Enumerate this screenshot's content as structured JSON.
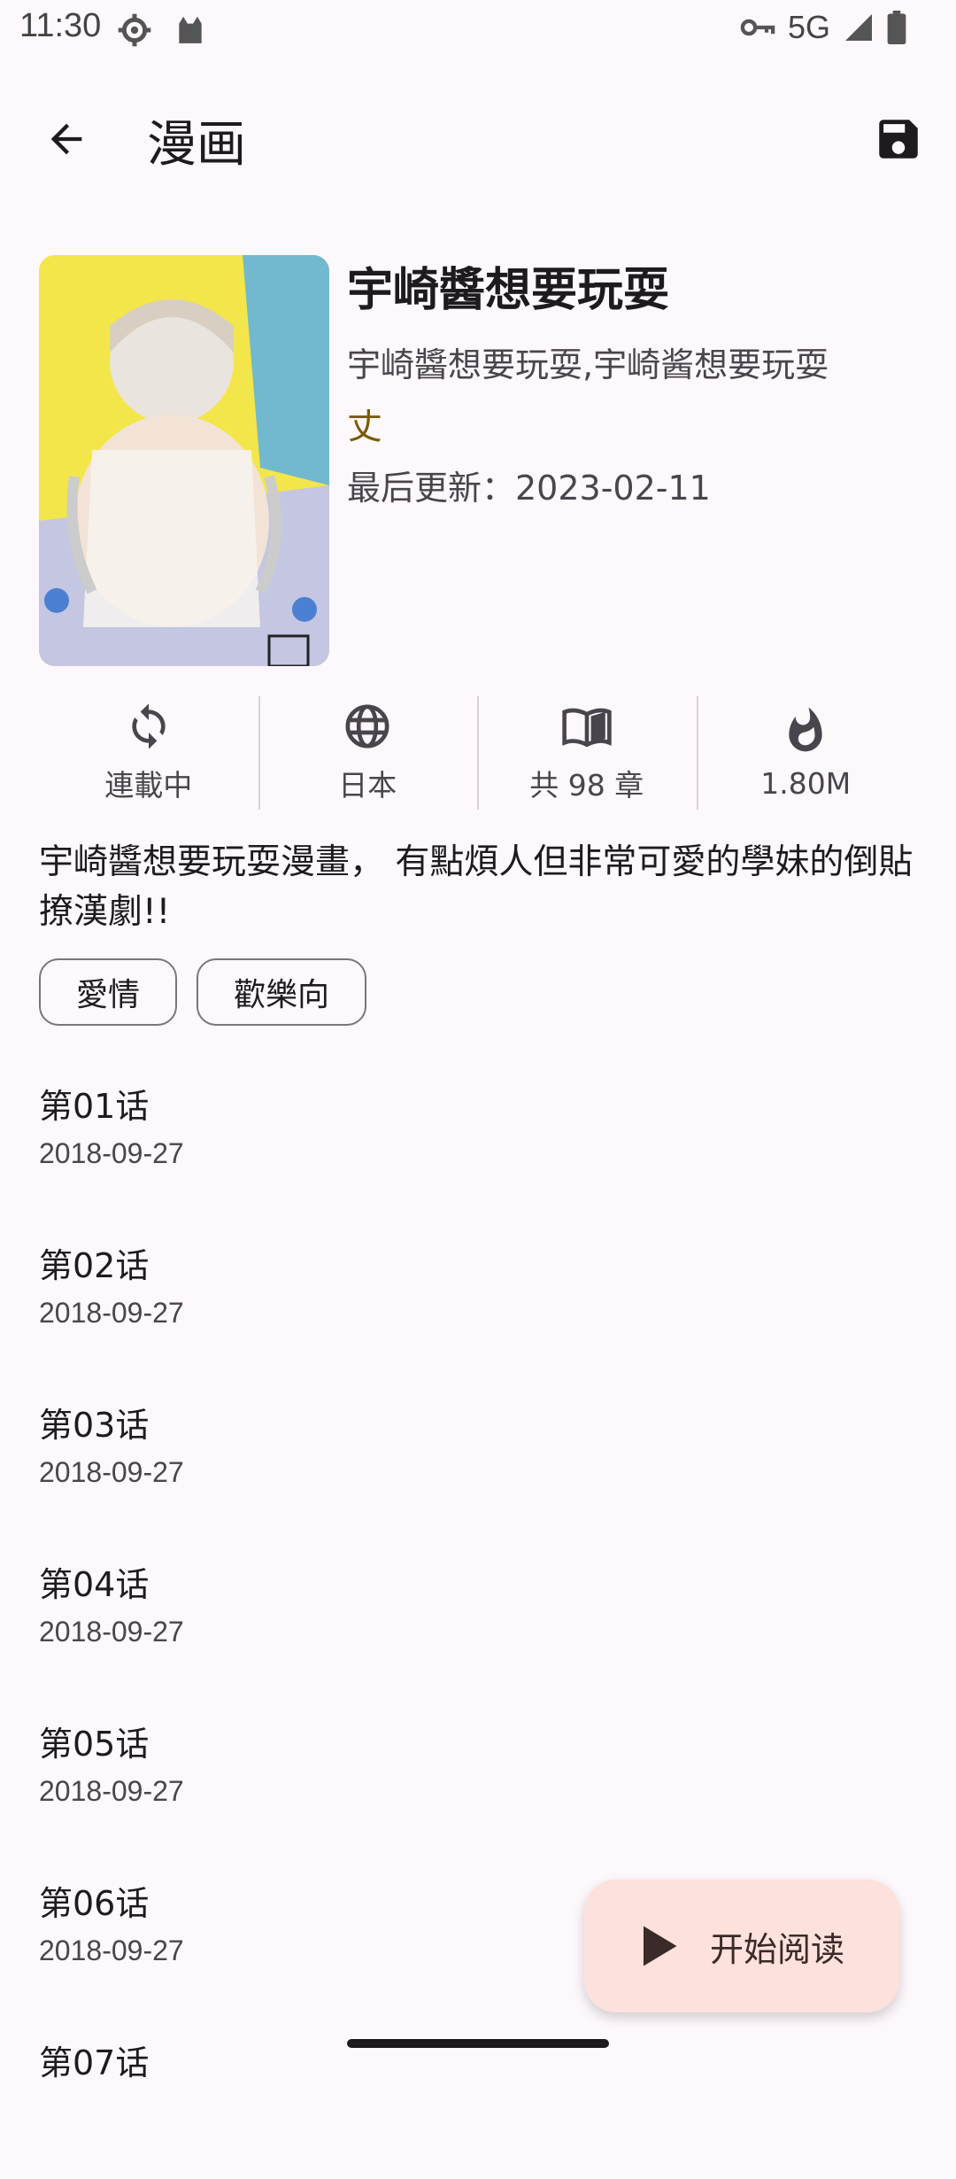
{
  "status_bar": {
    "time": "11:30",
    "network": "5G",
    "icons": [
      "settings-icon",
      "android-cat-icon",
      "vpn-key-icon",
      "signal-icon",
      "battery-icon"
    ]
  },
  "app_bar": {
    "title": "漫画",
    "back_icon": "arrow-back-icon",
    "save_icon": "save-icon"
  },
  "comic": {
    "title": "宇崎醬想要玩耍",
    "alt_names": "宇崎醬想要玩耍,宇崎酱想要玩耍",
    "author": "丈",
    "updated": "最后更新：2023-02-11",
    "description": "宇崎醬想要玩耍漫畫， 有點煩人但非常可愛的學妹的倒貼撩漢劇!!",
    "cover_alt": "宇崎醬想要玩耍 cover"
  },
  "stats": [
    {
      "icon": "refresh-icon",
      "label": "連載中"
    },
    {
      "icon": "globe-icon",
      "label": "日本"
    },
    {
      "icon": "book-open-icon",
      "label": "共 98 章"
    },
    {
      "icon": "flame-icon",
      "label": "1.80M"
    }
  ],
  "tags": [
    "愛情",
    "歡樂向"
  ],
  "chapters": [
    {
      "title": "第01话",
      "date": "2018-09-27"
    },
    {
      "title": "第02话",
      "date": "2018-09-27"
    },
    {
      "title": "第03话",
      "date": "2018-09-27"
    },
    {
      "title": "第04话",
      "date": "2018-09-27"
    },
    {
      "title": "第05话",
      "date": "2018-09-27"
    },
    {
      "title": "第06话",
      "date": "2018-09-27"
    },
    {
      "title": "第07话",
      "date": ""
    }
  ],
  "fab": {
    "label": "开始阅读",
    "icon": "play-icon"
  },
  "colors": {
    "background": "#fdf8fc",
    "fab": "#fde1dc",
    "author": "#7a5a00"
  }
}
